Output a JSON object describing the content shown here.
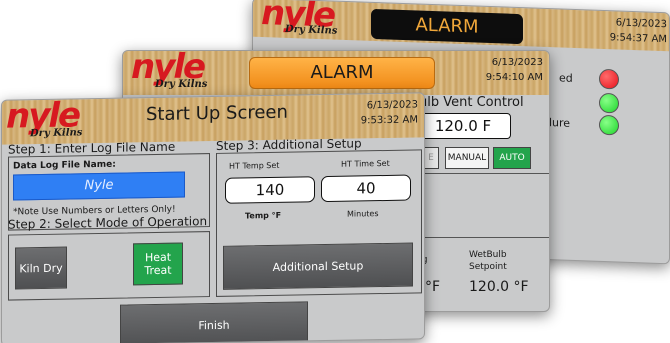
{
  "back_screen": {
    "alarm": "ALARM",
    "date": "6/13/2023",
    "time": "9:54:37 AM",
    "row_fragments": [
      "ed",
      "lure"
    ],
    "lamp_colors": [
      "#e8101a",
      "#1ed42b",
      "#1ed42b"
    ]
  },
  "mid_screen": {
    "alarm": "ALARM",
    "date": "6/13/2023",
    "time": "9:54:10 AM",
    "vent_title": "ulb Vent Control",
    "vent_value": "120.0 F",
    "mode_fragment": "E",
    "mode_manual": "MANUAL",
    "mode_auto": "AUTO",
    "setpoint_fragment": "ng",
    "wetbulb_label_1": "WetBulb",
    "wetbulb_label_2": "Setpoint",
    "left_unit_fragment": "°F",
    "wetbulb_value": "120.0 °F"
  },
  "front_screen": {
    "logo_main": "nyle",
    "logo_sub": "Dry Kilns",
    "title": "Start Up Screen",
    "date": "6/13/2023",
    "time": "9:53:32 AM",
    "step1_title": "Step 1:  Enter Log File Name",
    "log_file_label": "Data Log File Name:",
    "log_file_value": "Nyle",
    "log_note": "*Note Use Numbers or Letters Only!",
    "step2_title": "Step 2:  Select Mode of Operation",
    "kiln_dry": "Kiln Dry",
    "heat_treat_1": "Heat",
    "heat_treat_2": "Treat",
    "step3_title": "Step 3:  Additional Setup",
    "ht_temp_label": "HT Temp Set",
    "ht_time_label": "HT Time Set",
    "ht_temp_value": "140",
    "ht_time_value": "40",
    "temp_unit_label": "Temp °F",
    "time_unit_label": "Minutes",
    "additional_setup": "Additional Setup",
    "finish": "Finish"
  },
  "colors": {
    "logo_red": "#d71920",
    "alarm_orange": "#f08a17",
    "active_green": "#23a44c",
    "input_blue": "#2f7ff4"
  }
}
